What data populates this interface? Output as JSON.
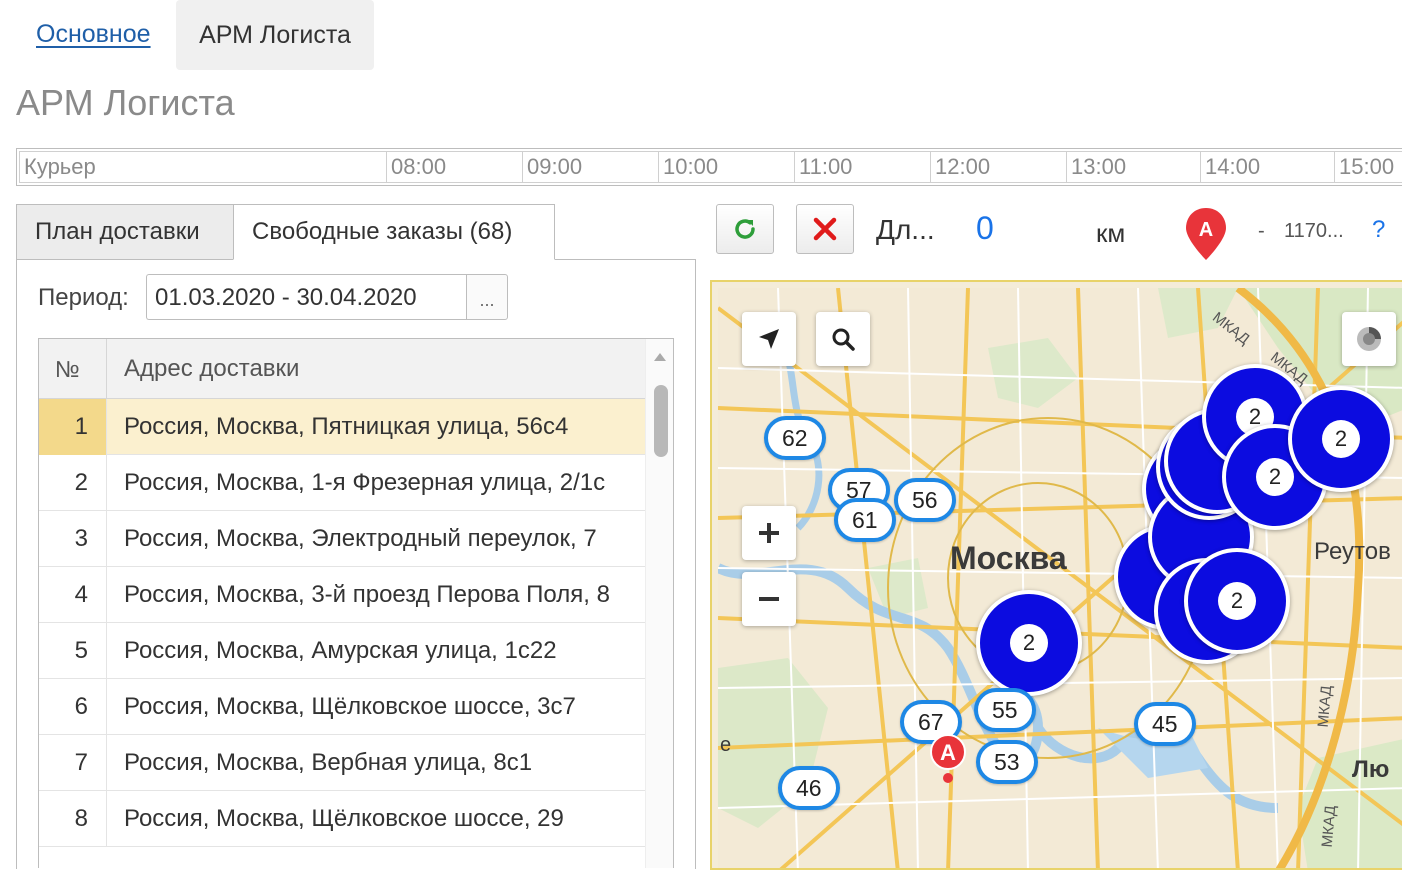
{
  "top_tabs": {
    "main": "Основное",
    "active": "АРМ Логиста"
  },
  "page_title": "АРМ Логиста",
  "timeline": {
    "courier_label": "Курьер",
    "hours": [
      "08:00",
      "09:00",
      "10:00",
      "11:00",
      "12:00",
      "13:00",
      "14:00",
      "15:00"
    ]
  },
  "left_tabs": {
    "plan": "План доставки",
    "free": "Свободные заказы (68)"
  },
  "period": {
    "label": "Период:",
    "value": "01.03.2020 - 30.04.2020",
    "button": "..."
  },
  "table": {
    "columns": {
      "num": "№",
      "address": "Адрес доставки"
    },
    "rows": [
      {
        "num": "1",
        "address": "Россия, Москва, Пятницкая улица, 56с4"
      },
      {
        "num": "2",
        "address": "Россия, Москва, 1-я Фрезерная улица, 2/1с"
      },
      {
        "num": "3",
        "address": "Россия, Москва, Электродный переулок, 7"
      },
      {
        "num": "4",
        "address": "Россия, Москва, 3-й проезд Перова Поля, 8"
      },
      {
        "num": "5",
        "address": "Россия, Москва, Амурская улица, 1с22"
      },
      {
        "num": "6",
        "address": "Россия, Москва, Щёлковское шоссе, 3с7"
      },
      {
        "num": "7",
        "address": "Россия, Москва, Вербная улица, 8с1"
      },
      {
        "num": "8",
        "address": "Россия, Москва, Щёлковское шоссе, 29"
      }
    ],
    "selected_row": 1
  },
  "toolbar": {
    "length_label": "Дл...",
    "length_value": "0",
    "unit": "км",
    "dash": "-",
    "start_address": "1170...",
    "help": "?"
  },
  "map": {
    "city_label": "Москва",
    "reutov_label": "Реутов",
    "lyu_label": "Лю",
    "e_label": "е",
    "mkad_labels": [
      "МКАД",
      "МКАД",
      "МКАД",
      "МКАД"
    ],
    "start_marker": "А",
    "clusters": [
      "2",
      "2",
      "2",
      "2",
      "2"
    ],
    "bubbles": [
      "62",
      "57",
      "56",
      "61",
      "55",
      "67",
      "53",
      "45",
      "46"
    ]
  },
  "colors": {
    "cluster": "#0c0ce0",
    "bubble_border": "#1e88e5",
    "link": "#1f5fa8",
    "selected_row": "#fbf0cf"
  }
}
